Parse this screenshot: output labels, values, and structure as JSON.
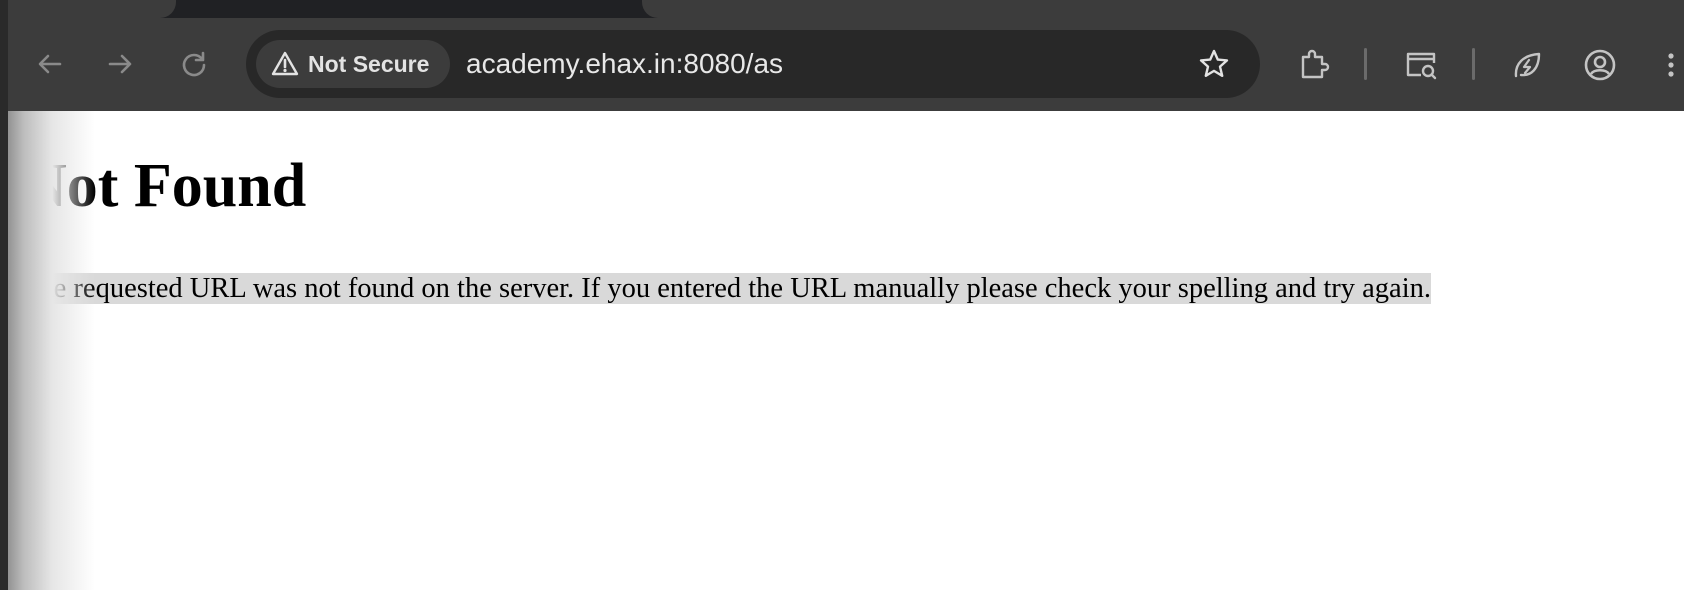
{
  "browser": {
    "nav": {
      "back_icon": "arrow-left-icon",
      "forward_icon": "arrow-right-icon",
      "reload_icon": "reload-icon"
    },
    "omnibox": {
      "security_label": "Not Secure",
      "security_icon": "warning-triangle-icon",
      "url": "academy.ehax.in:8080/as",
      "bookmark_icon": "star-outline-icon"
    },
    "toolbar_icons": [
      "extensions-puzzle-icon",
      "tab-search-icon",
      "performance-leaf-icon",
      "profile-avatar-icon",
      "menu-kebab-icon"
    ],
    "colors": {
      "tab_strip": "#202124",
      "toolbar": "#3c3c3c",
      "omnibox": "#282828",
      "icon": "#c4c4c4"
    }
  },
  "page": {
    "heading": "Not Found",
    "message": "The requested URL was not found on the server. If you entered the URL manually please check your spelling and try again.",
    "message_highlight": "#d9d9d9"
  }
}
